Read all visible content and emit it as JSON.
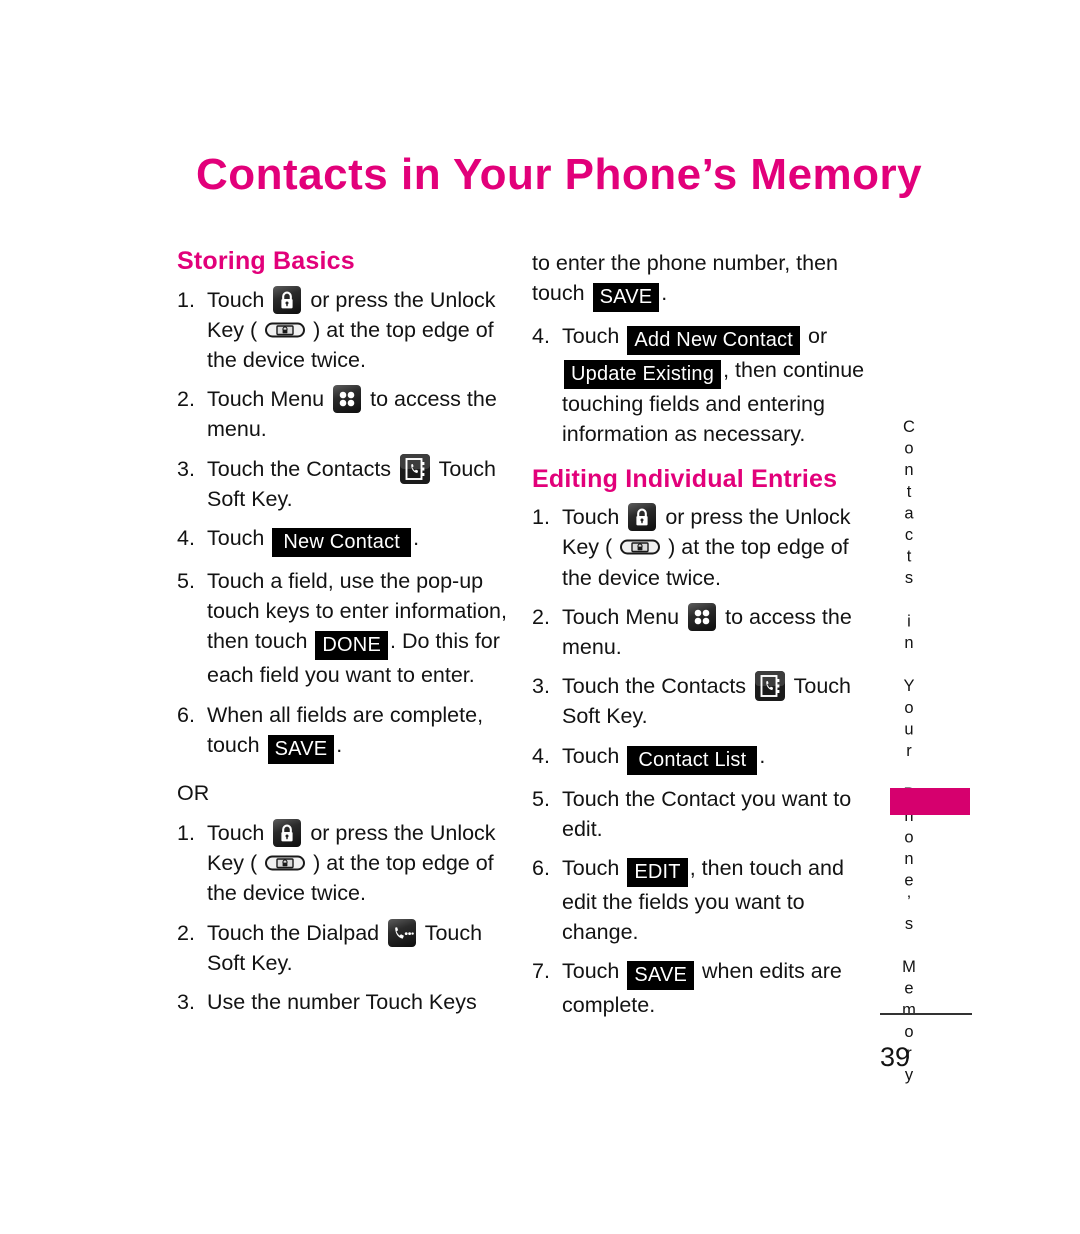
{
  "document": {
    "title": "Contacts in Your Phone’s Memory",
    "page_number": "39",
    "side_tab_text": "Contacts in Your Phone’s Memory",
    "accent_color": "#E2007A",
    "tab_color": "#D6006E"
  },
  "left_column": {
    "heading": "Storing Basics",
    "steps": [
      {
        "num": "1.",
        "part1": "Touch",
        "icon1": "lock-icon",
        "part2": "or press the Unlock Key (",
        "icon2": "unlock-key-icon",
        "part3": ") at the top edge of the device twice."
      },
      {
        "num": "2.",
        "part1": "Touch Menu",
        "icon1": "menu-grid-icon",
        "part2": "to access the menu."
      },
      {
        "num": "3.",
        "part1": "Touch the Contacts",
        "icon1": "contacts-icon",
        "part2": "Touch Soft Key."
      },
      {
        "num": "4.",
        "part1": "Touch",
        "key1": "New Contact",
        "part2": "."
      },
      {
        "num": "5.",
        "part1": "Touch a field, use the pop-up touch keys to enter information, then touch",
        "key1": "DONE",
        "part2": ". Do this for each field you want to enter."
      },
      {
        "num": "6.",
        "part1": "When all fields are complete, touch",
        "key1": "SAVE",
        "part2": "."
      }
    ],
    "or_label": "OR",
    "steps_or": [
      {
        "num": "1.",
        "part1": "Touch",
        "icon1": "lock-icon",
        "part2": "or press the Unlock Key (",
        "icon2": "unlock-key-icon",
        "part3": ") at the top edge of the device twice."
      },
      {
        "num": "2.",
        "part1": "Touch the Dialpad",
        "icon1": "dialpad-icon",
        "part2": "Touch Soft Key."
      },
      {
        "num": "3.",
        "part1": "Use the number Touch Keys"
      }
    ]
  },
  "right_column": {
    "continuation": {
      "part1": "to enter the phone number, then touch",
      "key1": "SAVE",
      "part2": "."
    },
    "steps_top": [
      {
        "num": "4.",
        "part1": "Touch",
        "key1": "Add New Contact",
        "part2": "or",
        "key2": "Update Existing",
        "part3": ", then continue touching fields and entering information as necessary."
      }
    ],
    "heading": "Editing Individual Entries",
    "steps": [
      {
        "num": "1.",
        "part1": "Touch",
        "icon1": "lock-icon",
        "part2": "or press the Unlock Key (",
        "icon2": "unlock-key-icon",
        "part3": ") at the top edge of the device twice."
      },
      {
        "num": "2.",
        "part1": "Touch Menu",
        "icon1": "menu-grid-icon",
        "part2": "to access the menu."
      },
      {
        "num": "3.",
        "part1": "Touch the Contacts",
        "icon1": "contacts-icon",
        "part2": "Touch Soft Key."
      },
      {
        "num": "4.",
        "part1": "Touch",
        "key1": "Contact List",
        "part2": "."
      },
      {
        "num": "5.",
        "part1": "Touch the Contact you want to edit."
      },
      {
        "num": "6.",
        "part1": "Touch",
        "key1": "EDIT",
        "part2": ", then touch and edit the fields you want to change."
      },
      {
        "num": "7.",
        "part1": "Touch",
        "key1": "SAVE",
        "part2": "when edits are complete."
      }
    ]
  }
}
